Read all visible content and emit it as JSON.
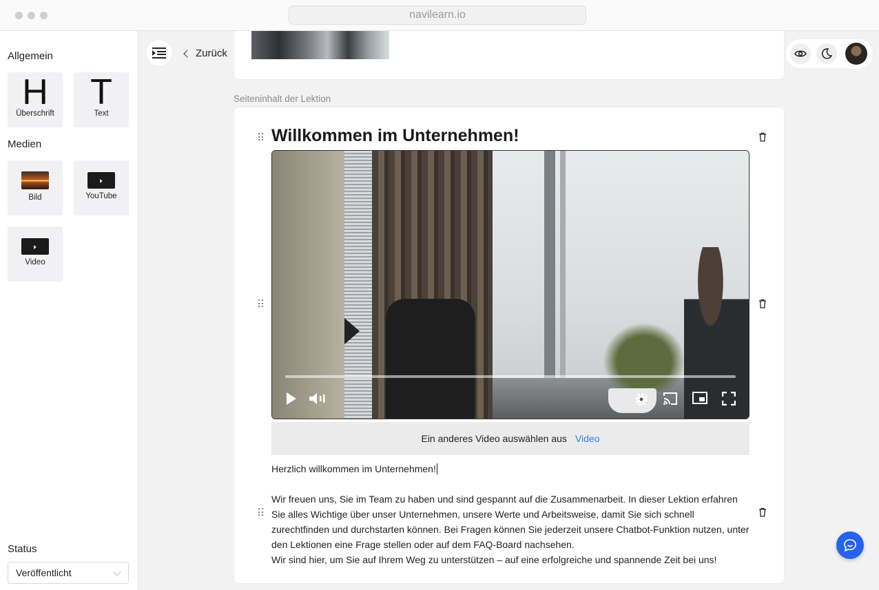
{
  "browser": {
    "url": "navilearn.io"
  },
  "sidebar": {
    "general_title": "Allgemein",
    "media_title": "Medien",
    "general_items": [
      {
        "glyph": "H",
        "label": "Überschrift"
      },
      {
        "glyph": "T",
        "label": "Text"
      }
    ],
    "media_items": [
      {
        "label": "Bild"
      },
      {
        "label": "YouTube"
      },
      {
        "label": "Video"
      }
    ],
    "status_title": "Status",
    "status_value": "Veröffentlicht"
  },
  "header": {
    "back_label": "Zurück"
  },
  "content": {
    "section_label": "Seiteninhalt der Lektion",
    "heading": "Willkommen im Unternehmen!",
    "video": {
      "progress": 0.0
    },
    "alt_video_text": "Ein anderes Video auswählen aus",
    "alt_video_link": "Video",
    "text_greeting": "Herzlich willkommen im Unternehmen!",
    "text_body": "Wir freuen uns, Sie im Team zu haben und sind gespannt auf die Zusammenarbeit. In dieser Lektion erfahren Sie alles Wichtige über unser Unternehmen, unsere Werte und Arbeitsweise, damit Sie sich schnell zurechtfinden und durchstarten können. Bei Fragen können Sie jederzeit unsere Chatbot-Funktion nutzen, unter den Lektionen eine Frage stellen oder auf dem FAQ-Board nachsehen.",
    "text_closing": "Wir sind hier, um Sie auf Ihrem Weg zu unterstützen – auf eine erfolgreiche und spannende Zeit bei uns!"
  },
  "icons": {
    "menu": "menu-indent-icon",
    "preview": "eye-icon",
    "theme": "moon-icon",
    "chat": "chat-bubble-icon",
    "delete": "trash-icon",
    "drag": "drag-handle-icon"
  },
  "colors": {
    "accent": "#2563eb",
    "link": "#2f7de1",
    "panel": "#f1f1f3"
  }
}
